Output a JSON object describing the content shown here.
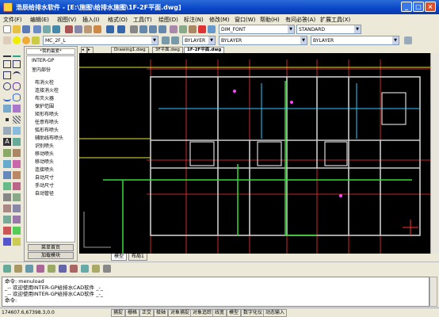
{
  "window": {
    "title": "浩辰给排水软件 - [E:\\施图\\给排水施图\\1F-2F平面.dwg]",
    "controls": [
      "minimize-icon",
      "maximize-icon",
      "close-icon"
    ]
  },
  "menu": [
    "文件(F)",
    "编辑(E)",
    "视图(V)",
    "插入(I)",
    "格式(O)",
    "工具(T)",
    "绘图(D)",
    "标注(N)",
    "修改(M)",
    "窗口(W)",
    "帮助(H)",
    "有问必答(A)",
    "扩展工具(X)"
  ],
  "toolbar2": {
    "layer": "MC_2F_L",
    "color": "BYLAYER",
    "linetype": "BYLAYER",
    "lineweight": "BYLAYER",
    "text_style": "DIM_FONT",
    "dim_style": "STANDARD"
  },
  "panel": {
    "header": "*我的最爱*",
    "items": [
      "INTER-GP",
      "室内部份",
      "布消火栓",
      "连接消火栓",
      "布灭火器",
      "保护范围",
      "矩形布喷头",
      "任意布喷头",
      "弧形布喷头",
      "辅助线布喷头",
      "识别喷头",
      "移动喷头",
      "移动喷头",
      "连接喷头",
      "自动尺寸",
      "手动尺寸",
      "自动管径"
    ],
    "buttons": [
      "菜单首页",
      "加载模块"
    ]
  },
  "file_tabs": [
    "Drawing1.dwg",
    "3F平面.dwg",
    "1F-2F平面.dwg"
  ],
  "active_file_tab": 2,
  "layout_tabs": [
    "模型",
    "布局1"
  ],
  "command": [
    "命令: menuload",
    "_-- 欢迎使用INTER-GP给排水CAD软件 _-_",
    "_-- 欢迎使用INTER-GP给排水CAD软件 _-_",
    "命令:"
  ],
  "status": {
    "coords": "174607.6,67398.3,0.0",
    "buttons": [
      "捕捉",
      "栅格",
      "正交",
      "极轴",
      "对象捕捉",
      "对象追踪",
      "线宽",
      "模型",
      "数字化仪",
      "动态输入"
    ]
  },
  "colors": {
    "title_bg": "#0a46c8",
    "canvas_bg": "#000000",
    "grid_axis": "#ff3333",
    "walls": "#cccccc",
    "pipes_green": "#33dd33",
    "pipes_cyan": "#33ccff",
    "pipes_yellow": "#e8e833"
  }
}
